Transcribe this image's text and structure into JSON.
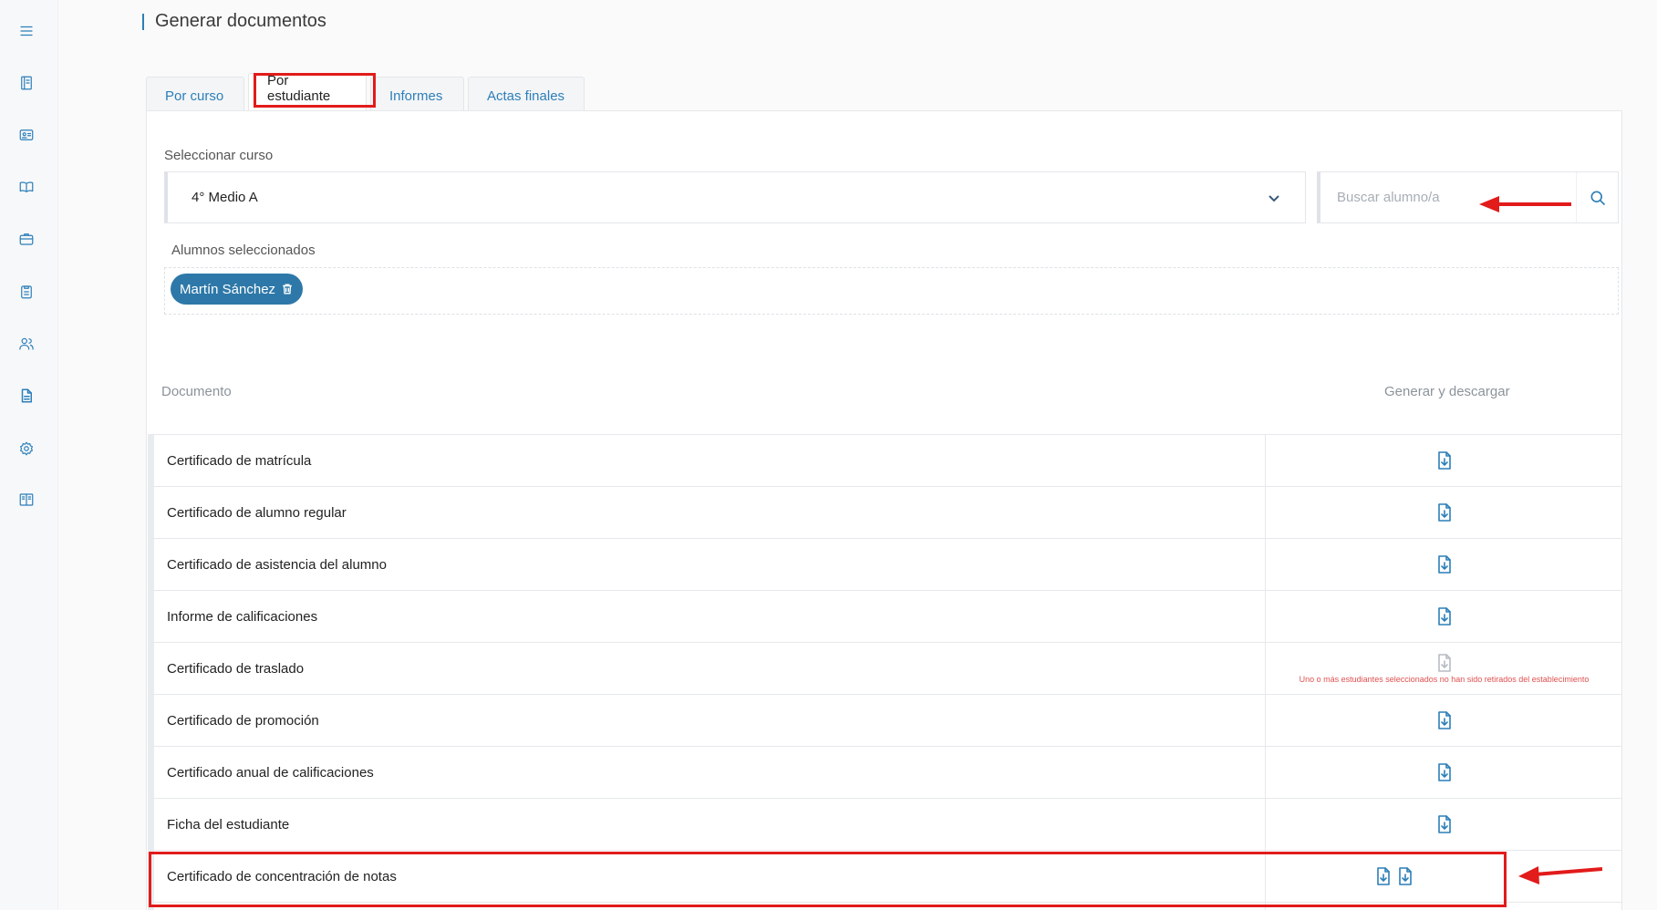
{
  "sidebar": {
    "items": [
      {
        "icon": "menu-icon"
      },
      {
        "icon": "notebook-icon"
      },
      {
        "icon": "id-card-icon"
      },
      {
        "icon": "book-open-icon"
      },
      {
        "icon": "briefcase-icon"
      },
      {
        "icon": "clipboard-icon"
      },
      {
        "icon": "users-icon"
      },
      {
        "icon": "document-icon"
      },
      {
        "icon": "settings-icon"
      },
      {
        "icon": "manual-icon"
      }
    ]
  },
  "page": {
    "title": "Generar documentos"
  },
  "tabs": [
    {
      "label": "Por curso",
      "active": false
    },
    {
      "label": "Por estudiante",
      "active": true
    },
    {
      "label": "Informes",
      "active": false
    },
    {
      "label": "Actas finales",
      "active": false
    }
  ],
  "filters": {
    "course_label": "Seleccionar curso",
    "course_value": "4° Medio A",
    "search_placeholder": "Buscar alumno/a",
    "students_label": "Alumnos seleccionados",
    "selected_students": [
      "Martín Sánchez"
    ]
  },
  "table": {
    "col_document": "Documento",
    "col_action": "Generar y descargar",
    "rows": [
      {
        "name": "Certificado de matrícula",
        "icons": 1,
        "enabled": true
      },
      {
        "name": "Certificado de alumno regular",
        "icons": 1,
        "enabled": true
      },
      {
        "name": "Certificado de asistencia del alumno",
        "icons": 1,
        "enabled": true
      },
      {
        "name": "Informe de calificaciones",
        "icons": 1,
        "enabled": true
      },
      {
        "name": "Certificado de traslado",
        "icons": 1,
        "enabled": false,
        "warning": "Uno o más estudiantes seleccionados no han sido retirados del establecimiento"
      },
      {
        "name": "Certificado de promoción",
        "icons": 1,
        "enabled": true
      },
      {
        "name": "Certificado anual de calificaciones",
        "icons": 1,
        "enabled": true
      },
      {
        "name": "Ficha del estudiante",
        "icons": 1,
        "enabled": true
      },
      {
        "name": "Certificado de concentración de notas",
        "icons": 2,
        "enabled": true
      }
    ]
  },
  "colors": {
    "accent": "#2c7fb8",
    "chip": "#2d78a8",
    "annotation": "#e21b1b",
    "warning": "#e05050"
  }
}
